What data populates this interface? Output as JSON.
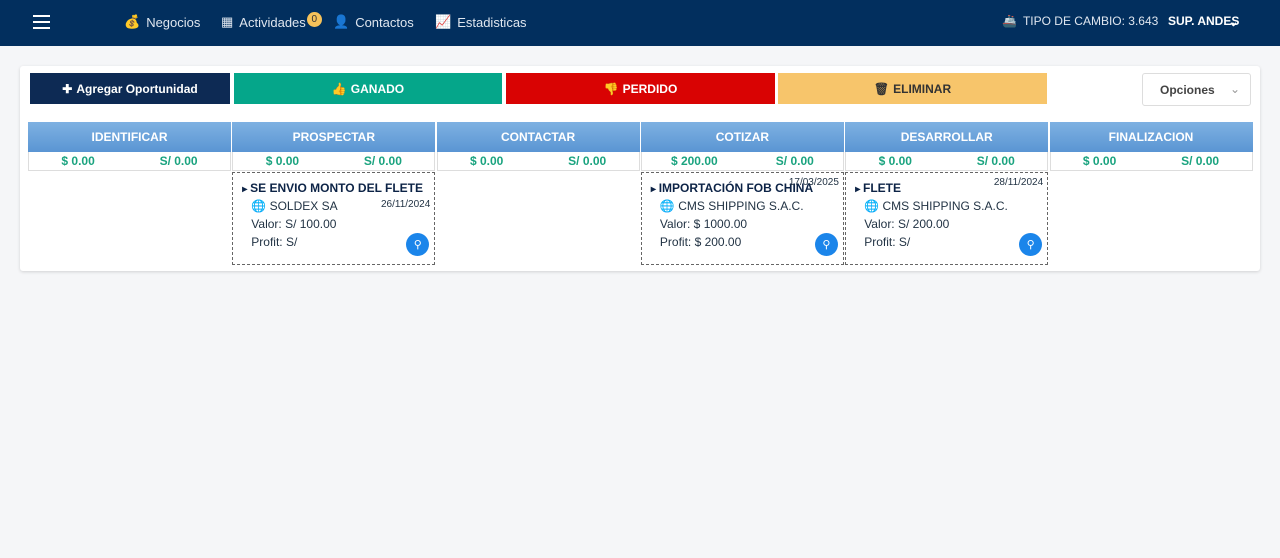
{
  "nav": {
    "items": [
      {
        "label": "Negocios",
        "icon": "money-bag-icon"
      },
      {
        "label": "Actividades",
        "icon": "calendar-icon",
        "badge": "0"
      },
      {
        "label": "Contactos",
        "icon": "user-icon"
      },
      {
        "label": "Estadisticas",
        "icon": "chart-icon"
      }
    ],
    "exchange": "TIPO DE CAMBIO: 3.643",
    "user": "SUP. ANDES"
  },
  "toolbar": {
    "add": "Agregar Oportunidad",
    "won": "GANADO",
    "lost": "PERDIDO",
    "delete": "ELIMINAR",
    "options": "Opciones"
  },
  "colors": {
    "nav": "#022f5e",
    "add": "#0d2a54",
    "won": "#05a68a",
    "lost": "#d90303",
    "delete": "#f7c56b",
    "totals": "#1aa37f",
    "search": "#1b85ea"
  },
  "columns": [
    {
      "title": "IDENTIFICAR",
      "usd": "$ 0.00",
      "pen": "S/ 0.00"
    },
    {
      "title": "PROSPECTAR",
      "usd": "$ 0.00",
      "pen": "S/ 0.00",
      "card": {
        "title": "SE ENVIO MONTO DEL FLETE",
        "company": "SOLDEX SA",
        "date": "26/11/2024",
        "valor": "Valor: S/ 100.00",
        "profit": "Profit: S/"
      }
    },
    {
      "title": "CONTACTAR",
      "usd": "$ 0.00",
      "pen": "S/ 0.00"
    },
    {
      "title": "COTIZAR",
      "usd": "$ 200.00",
      "pen": "S/ 0.00",
      "card": {
        "title": "IMPORTACIÓN FOB CHINA",
        "company": "CMS SHIPPING S.A.C.",
        "date": "17/03/2025",
        "valor": "Valor: $ 1000.00",
        "profit": "Profit: $ 200.00"
      }
    },
    {
      "title": "DESARROLLAR",
      "usd": "$ 0.00",
      "pen": "S/ 0.00",
      "card": {
        "title": "FLETE",
        "company": "CMS SHIPPING S.A.C.",
        "date": "28/11/2024",
        "valor": "Valor: S/ 200.00",
        "profit": "Profit: S/"
      }
    },
    {
      "title": "FINALIZACION",
      "usd": "$ 0.00",
      "pen": "S/ 0.00"
    }
  ]
}
